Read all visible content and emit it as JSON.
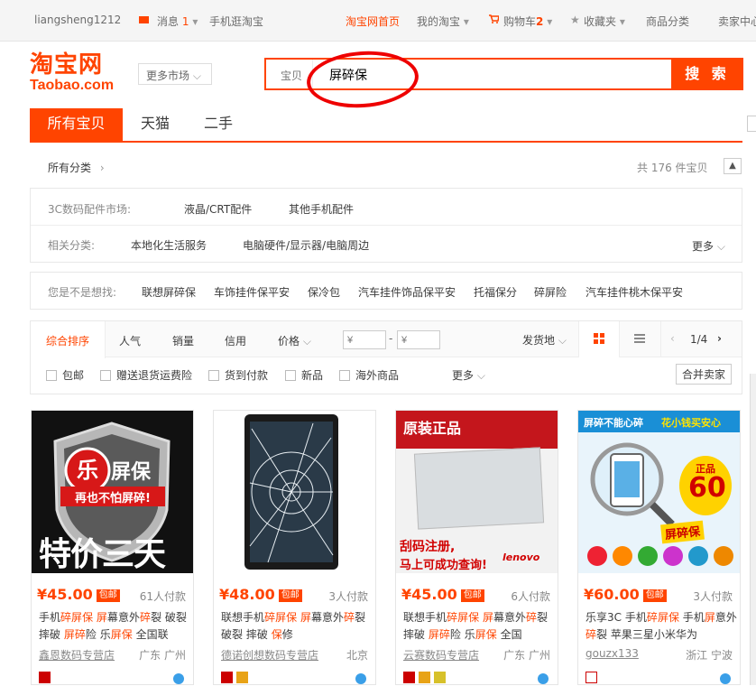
{
  "topbar": {
    "username": "liangsheng1212",
    "messages_label": "消息",
    "messages_count": "1",
    "mobile": "手机逛淘宝",
    "home": "淘宝网首页",
    "my_taobao": "我的淘宝",
    "cart_label": "购物车",
    "cart_count": "2",
    "favorites": "收藏夹",
    "categories": "商品分类",
    "seller_center": "卖家中心"
  },
  "logo": {
    "cn": "淘宝网",
    "en": "Taobao.com"
  },
  "market_button": "更多市场",
  "search": {
    "category": "宝贝",
    "query": "屏碎保",
    "button": "搜 索"
  },
  "tabs": [
    "所有宝贝",
    "天猫",
    "二手"
  ],
  "breadcrumb": {
    "label": "所有分类",
    "result_count": "共 176 件宝贝"
  },
  "filters": {
    "market_label": "3C数码配件市场:",
    "market_items": [
      "液晶/CRT配件",
      "其他手机配件"
    ],
    "related_label": "相关分类:",
    "related_items": [
      "本地化生活服务",
      "电脑硬件/显示器/电脑周边"
    ],
    "more": "更多"
  },
  "suggest": {
    "label": "您是不是想找:",
    "items": [
      "联想屏碎保",
      "车饰挂件保平安",
      "保冷包",
      "汽车挂件饰品保平安",
      "托福保分",
      "碎屏险",
      "汽车挂件桃木保平安"
    ]
  },
  "sort": {
    "items": [
      "综合排序",
      "人气",
      "销量",
      "信用",
      "价格"
    ],
    "price_min_placeholder": "¥",
    "price_max_placeholder": "¥",
    "ship_from": "发货地",
    "page": "1/4",
    "options": [
      "包邮",
      "赠送退货运费险",
      "货到付款",
      "新品",
      "海外商品"
    ],
    "more": "更多",
    "merge": "合并卖家"
  },
  "products": [
    {
      "price": "¥45.00",
      "badge": "包邮",
      "deals": "61人付款",
      "title": "手机碎屏保 屏幕意外碎裂 破裂 摔破 屏碎险 乐屏保 全国联",
      "shop": "鑫恩数码专营店",
      "location": "广东 广州",
      "image_text_1": "屏保",
      "image_text_2": "再也不怕屏碎!",
      "image_text_3": "特价三天"
    },
    {
      "price": "¥48.00",
      "badge": "包邮",
      "deals": "3人付款",
      "title": "联想手机碎屏保 屏幕意外碎裂 破裂 摔破 保修",
      "shop": "德诺创想数码专营店",
      "location": "北京"
    },
    {
      "price": "¥45.00",
      "badge": "包邮",
      "deals": "6人付款",
      "title": "联想手机碎屏保 屏幕意外碎裂 摔破 屏碎险 乐屏保 全国",
      "shop": "云赛数码专营店",
      "location": "广东 广州",
      "image_text_1": "原装正品",
      "image_text_2": "刮码注册,",
      "image_text_3": "马上可成功查询!",
      "image_text_4": "lenovo"
    },
    {
      "price": "¥60.00",
      "badge": "包邮",
      "deals": "3人付款",
      "title": "乐享3C 手机碎屏保 手机屏意外碎裂 苹果三星小米华为",
      "shop": "gouzx133",
      "location": "浙江 宁波",
      "image_text_1": "屏碎不能心碎",
      "image_text_2": "花小钱买安心",
      "image_text_3": "正品",
      "image_text_4": "60",
      "image_text_5": "屏碎保"
    }
  ],
  "colors": {
    "accent": "#ff4400",
    "annotation": "#e00000"
  }
}
